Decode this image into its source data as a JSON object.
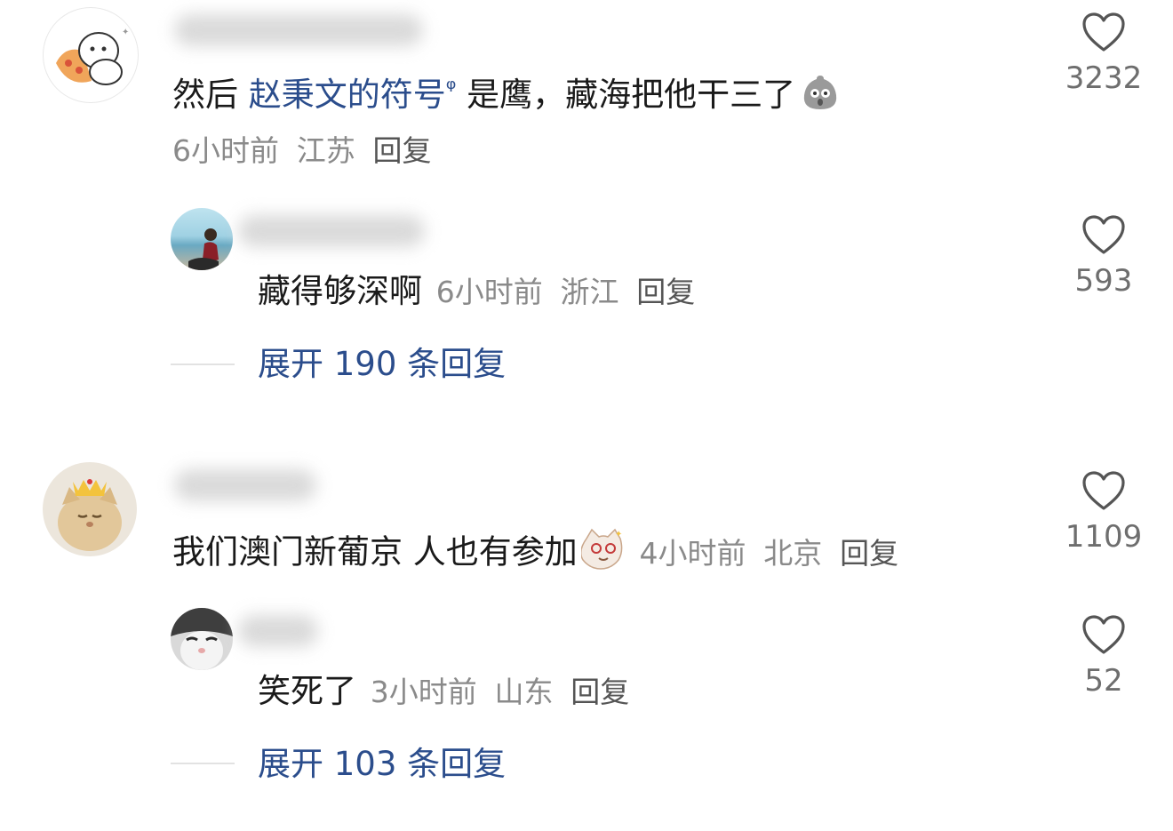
{
  "comments": [
    {
      "text_before": "然后 ",
      "link_text": "赵秉文的符号",
      "search_glyph": "ᵠ",
      "text_after": " 是鹰，藏海把他干三了",
      "emoji_icon": "shocked-face-emoji",
      "time": "6小时前",
      "location": "江苏",
      "reply": "回复",
      "likes": "3232",
      "reply_thread": {
        "text": "藏得够深啊",
        "time": "6小时前",
        "location": "浙江",
        "reply": "回复",
        "likes": "593"
      },
      "expand": "展开 190 条回复"
    },
    {
      "text": "我们澳门新葡京 人也有参加",
      "emoji_icon": "cat-emoji",
      "time": "4小时前",
      "location": "北京",
      "reply": "回复",
      "likes": "1109",
      "reply_thread": {
        "text": "笑死了",
        "time": "3小时前",
        "location": "山东",
        "reply": "回复",
        "likes": "52"
      },
      "expand": "展开 103 条回复"
    }
  ],
  "icons": {
    "like": "heart-icon"
  }
}
